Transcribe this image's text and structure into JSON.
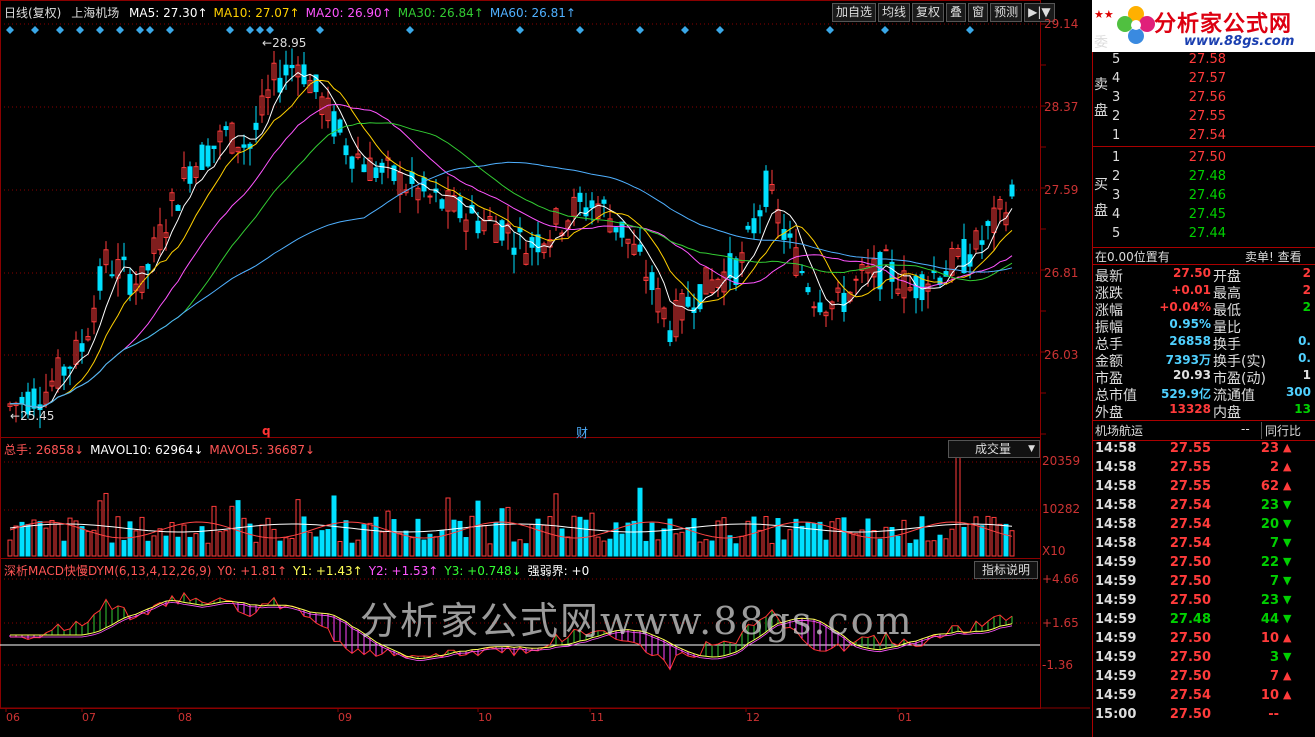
{
  "header": {
    "period": "日线(复权)",
    "stock": "上海机场",
    "ma": [
      {
        "label": "MA5: 27.30↑",
        "color": "#ffffff"
      },
      {
        "label": "MA10: 27.07↑",
        "color": "#ffd000"
      },
      {
        "label": "MA20: 26.90↑",
        "color": "#ff55ff"
      },
      {
        "label": "MA30: 26.84↑",
        "color": "#33cc33"
      },
      {
        "label": "MA60: 26.81↑",
        "color": "#4fb0ff"
      }
    ]
  },
  "toolbar": {
    "buttons": [
      "加自选",
      "均线",
      "复权",
      "叠",
      "窗",
      "预测",
      "▶|▼"
    ]
  },
  "price_axis": {
    "labels": [
      "29.14",
      "28.37",
      "27.59",
      "26.81",
      "26.03"
    ]
  },
  "annotations": {
    "high": "28.95",
    "low": "25.45",
    "q": "q",
    "cai": "财"
  },
  "volume_panel": {
    "legend": [
      {
        "label": "总手: 26858↓",
        "color": "#ff5555"
      },
      {
        "label": "MAVOL10: 62964↓",
        "color": "#ffffff"
      },
      {
        "label": "MAVOL5: 36687↓",
        "color": "#ff5555"
      }
    ],
    "selector": "成交量",
    "axis": [
      "20359",
      "10282"
    ],
    "unit": "X10"
  },
  "macd_panel": {
    "legend": [
      {
        "label": "深析MACD快慢DYM(6,13,4,12,26,9)",
        "color": "#ff5555"
      },
      {
        "label": "Y0: +1.81↑",
        "color": "#ff5555"
      },
      {
        "label": "Y1: +1.43↑",
        "color": "#ffff55"
      },
      {
        "label": "Y2: +1.53↑",
        "color": "#ff55ff"
      },
      {
        "label": "Y3: +0.748↓",
        "color": "#33ff33"
      },
      {
        "label": "强弱界: +0",
        "color": "#ffffff"
      }
    ],
    "help": "指标说明",
    "axis": [
      "+4.66",
      "+1.65",
      "-1.36"
    ]
  },
  "months": [
    "06",
    "07",
    "08",
    "09",
    "10",
    "11",
    "12",
    "01"
  ],
  "watermark": "分析家公式网www.88gs.com",
  "logo": {
    "title": "分析家公式网",
    "url": "www.88gs.com"
  },
  "order_book": {
    "labels": {
      "wei": "委",
      "sell": "卖盘",
      "buy": "买盘"
    },
    "sell": [
      {
        "n": "5",
        "p": "27.58"
      },
      {
        "n": "4",
        "p": "27.57"
      },
      {
        "n": "3",
        "p": "27.56"
      },
      {
        "n": "2",
        "p": "27.55"
      },
      {
        "n": "1",
        "p": "27.54"
      }
    ],
    "buy": [
      {
        "n": "1",
        "p": "27.50"
      },
      {
        "n": "2",
        "p": "27.48"
      },
      {
        "n": "3",
        "p": "27.46"
      },
      {
        "n": "4",
        "p": "27.45"
      },
      {
        "n": "5",
        "p": "27.44"
      }
    ]
  },
  "status_line": {
    "left": "在0.00位置有",
    "right": "卖单! 查看"
  },
  "quote": [
    {
      "k": "最新",
      "v": "27.50",
      "vc": "red",
      "k2": "开盘",
      "v2": "2",
      "v2c": "red"
    },
    {
      "k": "涨跌",
      "v": "+0.01",
      "vc": "red",
      "k2": "最高",
      "v2": "2",
      "v2c": "red"
    },
    {
      "k": "涨幅",
      "v": "+0.04%",
      "vc": "red",
      "k2": "最低",
      "v2": "2",
      "v2c": "green"
    },
    {
      "k": "振幅",
      "v": "0.95%",
      "vc": "cyan",
      "k2": "量比",
      "v2": "",
      "v2c": "white"
    },
    {
      "k": "总手",
      "v": "26858",
      "vc": "cyan",
      "k2": "换手",
      "v2": "0.",
      "v2c": "cyan"
    },
    {
      "k": "金额",
      "v": "7393万",
      "vc": "cyan",
      "k2": "换手(实)",
      "v2": "0.",
      "v2c": "cyan"
    },
    {
      "k": "市盈",
      "v": "20.93",
      "vc": "white",
      "k2": "市盈(动)",
      "v2": "1",
      "v2c": "white"
    },
    {
      "k": "总市值",
      "v": "529.9亿",
      "vc": "cyan",
      "k2": "流通值",
      "v2": "300",
      "v2c": "cyan"
    },
    {
      "k": "外盘",
      "v": "13328",
      "vc": "red",
      "k2": "内盘",
      "v2": "13",
      "v2c": "green"
    }
  ],
  "tick_header": {
    "left": "机场航运",
    "dash": "--",
    "right": "同行比"
  },
  "ticks": [
    {
      "t": "14:58",
      "p": "27.55",
      "v": "23",
      "d": "up"
    },
    {
      "t": "14:58",
      "p": "27.55",
      "v": "2",
      "d": "up"
    },
    {
      "t": "14:58",
      "p": "27.55",
      "v": "62",
      "d": "up"
    },
    {
      "t": "14:58",
      "p": "27.54",
      "v": "23",
      "d": "down"
    },
    {
      "t": "14:58",
      "p": "27.54",
      "v": "20",
      "d": "down"
    },
    {
      "t": "14:58",
      "p": "27.54",
      "v": "7",
      "d": "down"
    },
    {
      "t": "14:59",
      "p": "27.50",
      "v": "22",
      "d": "down"
    },
    {
      "t": "14:59",
      "p": "27.50",
      "v": "7",
      "d": "down"
    },
    {
      "t": "14:59",
      "p": "27.50",
      "v": "23",
      "d": "down"
    },
    {
      "t": "14:59",
      "p": "27.48",
      "v": "44",
      "d": "down"
    },
    {
      "t": "14:59",
      "p": "27.50",
      "v": "10",
      "d": "up"
    },
    {
      "t": "14:59",
      "p": "27.50",
      "v": "3",
      "d": "down"
    },
    {
      "t": "14:59",
      "p": "27.50",
      "v": "7",
      "d": "up"
    },
    {
      "t": "14:59",
      "p": "27.54",
      "v": "10",
      "d": "up"
    },
    {
      "t": "15:00",
      "p": "27.50",
      "v": "--",
      "d": "none"
    }
  ],
  "colors": {
    "up": "#ff3b3b",
    "down": "#00e0ff",
    "grid": "#8a0000",
    "ma5": "#ffffff",
    "ma10": "#ffd000",
    "ma20": "#ff55ff",
    "ma30": "#33cc33",
    "ma60": "#4fb0ff"
  }
}
